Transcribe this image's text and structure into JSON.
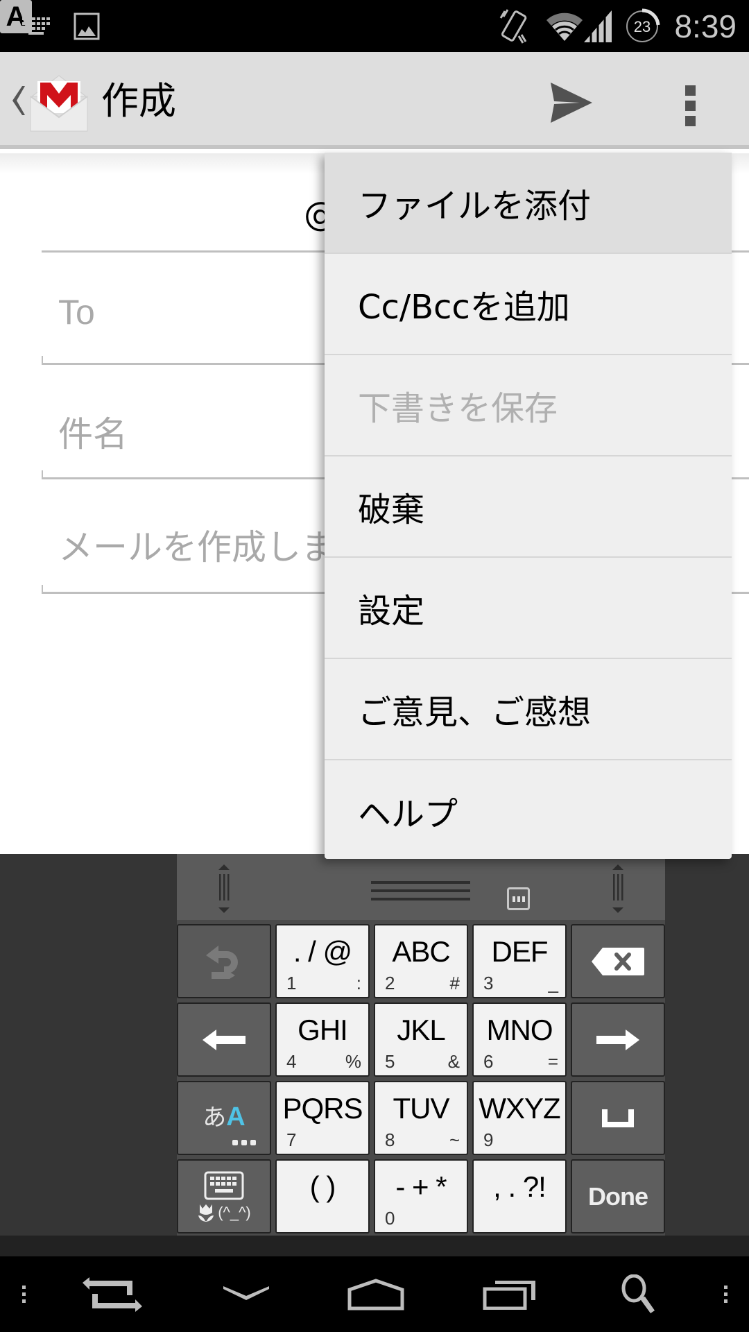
{
  "status_bar": {
    "time": "8:39",
    "ime_indicator": "A",
    "notification_count": "23",
    "icons": [
      "keyboard-icon",
      "image-icon",
      "ime-indicator-icon",
      "vibrate-icon",
      "wifi-icon",
      "cell-signal-icon",
      "data-usage-icon"
    ]
  },
  "action_bar": {
    "title": "作成",
    "icons": [
      "back-chevron-icon",
      "gmail-logo-icon",
      "send-icon",
      "overflow-menu-icon"
    ]
  },
  "compose": {
    "from_partial": "@",
    "to_placeholder": "To",
    "subject_placeholder": "件名",
    "body_placeholder": "メールを作成しま"
  },
  "overflow_menu": {
    "items": [
      {
        "label": "ファイルを添付",
        "state": "pressed"
      },
      {
        "label": "Cc/Bccを追加",
        "state": "enabled"
      },
      {
        "label": "下書きを保存",
        "state": "disabled"
      },
      {
        "label": "破棄",
        "state": "enabled"
      },
      {
        "label": "設定",
        "state": "enabled"
      },
      {
        "label": "ご意見、ご感想",
        "state": "enabled"
      },
      {
        "label": "ヘルプ",
        "state": "enabled"
      }
    ]
  },
  "keyboard": {
    "rows": [
      [
        {
          "type": "icon",
          "icon": "undo-icon",
          "style": "dim"
        },
        {
          "main": ". / @",
          "sub_left": "1",
          "sub_right": ":"
        },
        {
          "main": "ABC",
          "sub_left": "2",
          "sub_right": "#"
        },
        {
          "main": "DEF",
          "sub_left": "3",
          "sub_right": "_"
        },
        {
          "type": "icon",
          "icon": "backspace-icon"
        }
      ],
      [
        {
          "type": "icon",
          "icon": "arrow-left-icon"
        },
        {
          "main": "GHI",
          "sub_left": "4",
          "sub_right": "%"
        },
        {
          "main": "JKL",
          "sub_left": "5",
          "sub_right": "&"
        },
        {
          "main": "MNO",
          "sub_left": "6",
          "sub_right": "="
        },
        {
          "type": "icon",
          "icon": "arrow-right-icon"
        }
      ],
      [
        {
          "type": "icon",
          "icon": "input-mode-toggle-icon",
          "mode_label": "あ",
          "mode_active": "A"
        },
        {
          "main": "PQRS",
          "sub_left": "7",
          "sub_right": ""
        },
        {
          "main": "TUV",
          "sub_left": "8",
          "sub_right": "~"
        },
        {
          "main": "WXYZ",
          "sub_left": "9",
          "sub_right": ""
        },
        {
          "type": "icon",
          "icon": "space-icon"
        }
      ],
      [
        {
          "type": "icon",
          "icon": "keyboard-emoji-icon",
          "emoticon": "(^_^)"
        },
        {
          "main": "( )",
          "sub_left": "",
          "sub_right": ""
        },
        {
          "main": "- + *",
          "sub_left": "0",
          "sub_right": ""
        },
        {
          "main": ", . ?!",
          "sub_left": "",
          "sub_right": ""
        },
        {
          "type": "text",
          "label": "Done"
        }
      ]
    ]
  },
  "nav_bar": {
    "buttons": [
      "menu-dots-left-icon",
      "rotate-icon",
      "hide-keyboard-icon",
      "home-icon",
      "recent-apps-icon",
      "search-icon",
      "menu-dots-right-icon"
    ]
  },
  "colors": {
    "action_bar_bg": "#dedede",
    "gmail_red": "#d0121a",
    "menu_bg": "#efefef",
    "menu_pressed_bg": "#dedede",
    "disabled_text": "#b0b0b0",
    "placeholder_text": "#a9a9a9",
    "keyboard_bg": "#353535",
    "ime_accent": "#4fc3e6"
  }
}
